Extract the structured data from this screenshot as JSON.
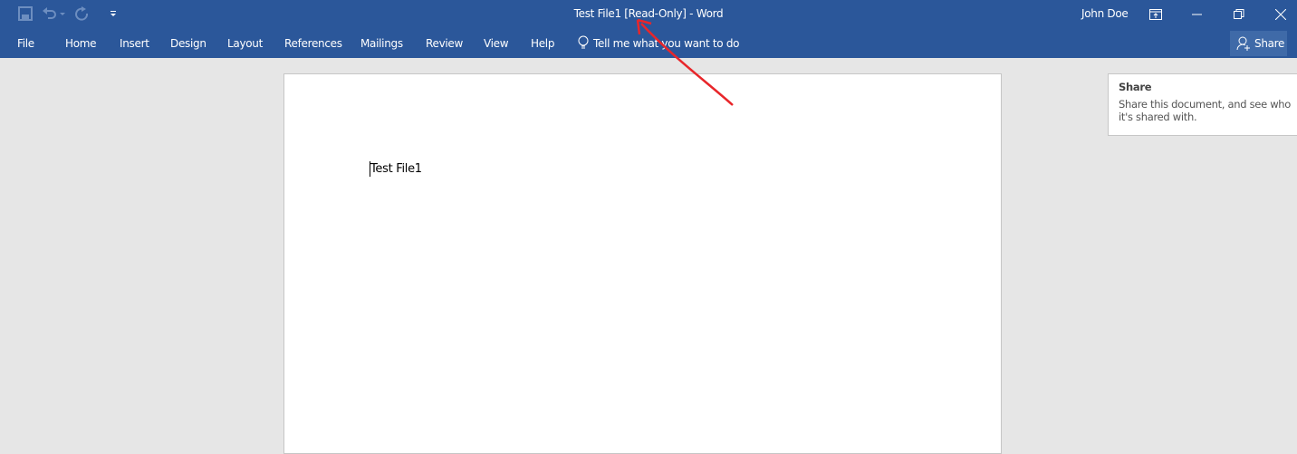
{
  "titlebar": {
    "title": "Test File1 [Read-Only]  -  Word",
    "user": "John Doe"
  },
  "ribbon": {
    "tabs": [
      "File",
      "Home",
      "Insert",
      "Design",
      "Layout",
      "References",
      "Mailings",
      "Review",
      "View",
      "Help"
    ],
    "tell_me": "Tell me what you want to do",
    "share": "Share"
  },
  "document": {
    "text": "Test File1"
  },
  "tooltip": {
    "title": "Share",
    "body": "Share this document, and see who it's shared with."
  },
  "colors": {
    "brand": "#2b579a",
    "annotation": "#e8262a"
  }
}
